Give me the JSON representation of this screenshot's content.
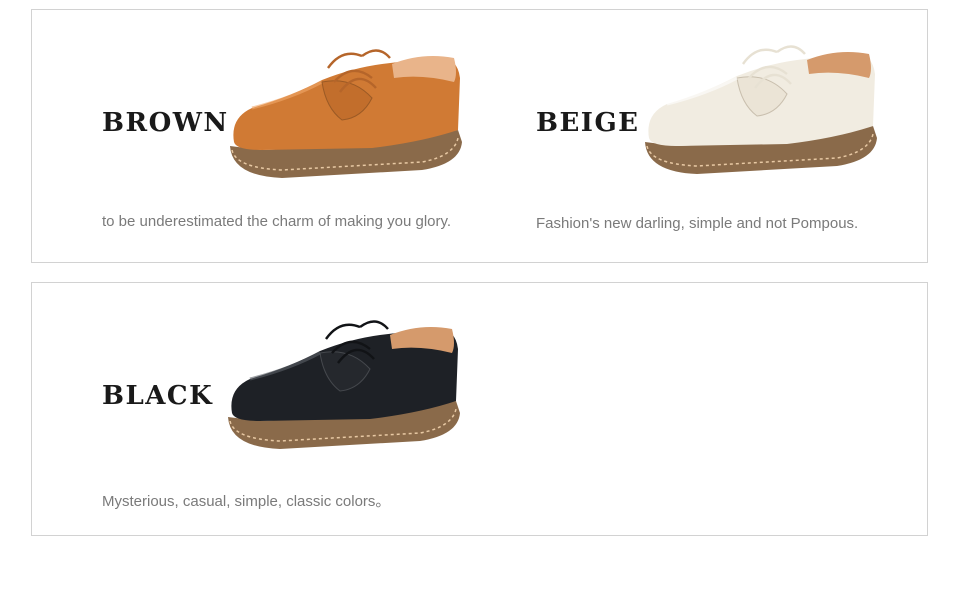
{
  "products": [
    {
      "name": "BROWN",
      "caption": "to be underestimated the charm of making you glory.",
      "upper_color": "#d2803a",
      "sole_color": "#7a5a3c"
    },
    {
      "name": "BEIGE",
      "caption": "Fashion's new darling, simple and not Pompous.",
      "upper_color": "#f1ece1",
      "sole_color": "#7a5a3c"
    },
    {
      "name": "BLACK",
      "caption": "Mysterious, casual, simple, classic colors。",
      "upper_color": "#1e2126",
      "sole_color": "#7a5a3c"
    }
  ]
}
